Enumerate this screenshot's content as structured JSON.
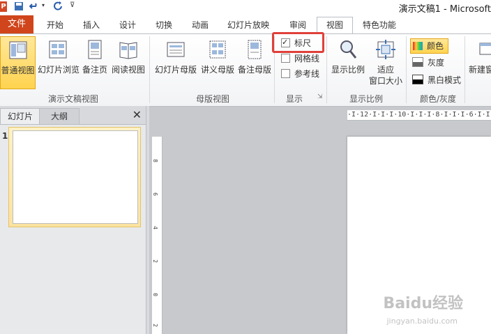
{
  "title_bar": {
    "title": "演示文稿1 - Microsoft"
  },
  "tabs": {
    "file": "文件",
    "items": [
      "开始",
      "插入",
      "设计",
      "切换",
      "动画",
      "幻灯片放映",
      "审阅",
      "视图",
      "特色功能"
    ],
    "active": "视图"
  },
  "ribbon": {
    "groups": {
      "presentation_views": {
        "label": "演示文稿视图",
        "buttons": [
          "普通视图",
          "幻灯片浏览",
          "备注页",
          "阅读视图"
        ]
      },
      "master_views": {
        "label": "母版视图",
        "buttons": [
          "幻灯片母版",
          "讲义母版",
          "备注母版"
        ]
      },
      "show": {
        "label": "显示",
        "checkboxes": [
          {
            "label": "标尺",
            "checked": true
          },
          {
            "label": "网格线",
            "checked": false
          },
          {
            "label": "参考线",
            "checked": false
          }
        ]
      },
      "zoom": {
        "label": "显示比例",
        "buttons": [
          "显示比例",
          "适应",
          "窗口大小"
        ]
      },
      "color": {
        "label": "颜色/灰度",
        "options": [
          "颜色",
          "灰度",
          "黑白模式"
        ]
      },
      "window": {
        "buttons": [
          "新建窗"
        ]
      }
    }
  },
  "left_pane": {
    "tabs": [
      "幻灯片",
      "大纲"
    ],
    "close_glyph": "✕",
    "slide_number": "1"
  },
  "ruler": {
    "horizontal_text": "·I·12·I·I·I·10·I·I·I·8·I·I·I·6·I·I·I·4",
    "vertical_ticks": [
      "8",
      "6",
      "4",
      "2",
      "0",
      "2"
    ]
  },
  "watermark": {
    "text": "Baidu经验",
    "url": "jingyan.baidu.com"
  },
  "colors": {
    "file_tab": "#d0451b",
    "highlight": "#e0403a",
    "active_view": "#ffd34f",
    "app_logo": "#d24726"
  }
}
